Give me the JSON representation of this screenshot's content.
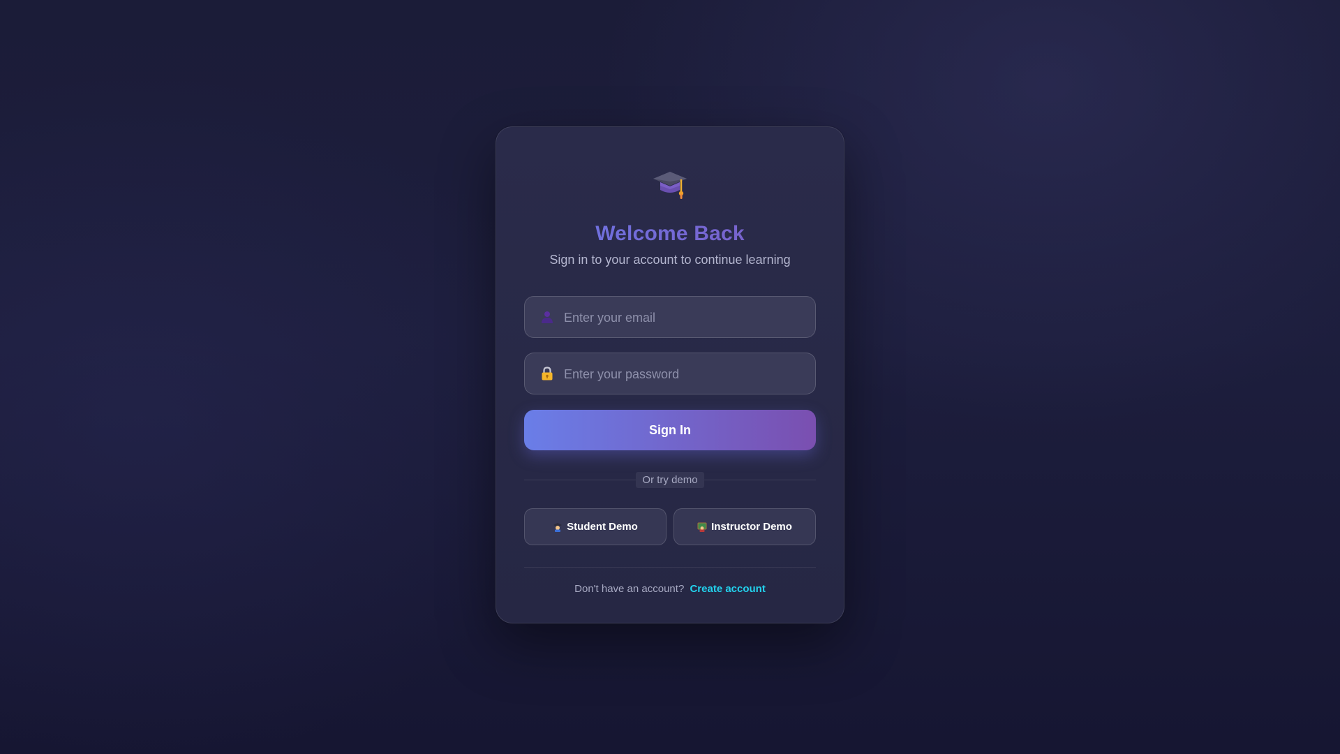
{
  "app": {
    "logo_icon": "graduation-cap-icon",
    "title": "Welcome Back",
    "subtitle": "Sign in to your account to continue learning"
  },
  "form": {
    "email": {
      "icon": "user-icon",
      "value": "",
      "placeholder": "Enter your email"
    },
    "password": {
      "icon": "lock-icon",
      "value": "",
      "placeholder": "Enter your password"
    },
    "submit_label": "Sign In"
  },
  "demo": {
    "divider_label": "Or try demo",
    "student": {
      "icon": "student-icon",
      "label": "Student Demo"
    },
    "instructor": {
      "icon": "instructor-icon",
      "label": "Instructor Demo"
    }
  },
  "footer": {
    "prompt": "Don't have an account?",
    "link_label": "Create account"
  },
  "colors": {
    "background": "#1d1e3d",
    "card": "#2a2b4a",
    "accent_start": "#6a7ee8",
    "accent_end": "#7a4fb0",
    "link": "#22d3ee"
  }
}
